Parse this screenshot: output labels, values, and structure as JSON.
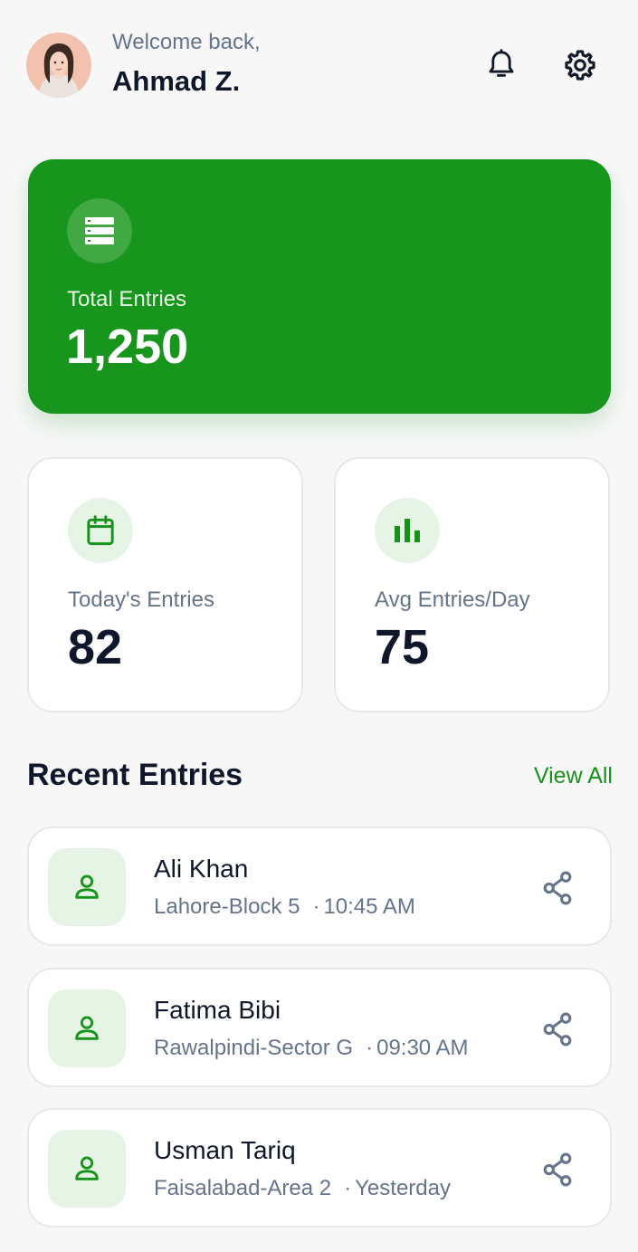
{
  "header": {
    "welcome": "Welcome back,",
    "user_name": "Ahmad Z.",
    "avatar_icon": "avatar",
    "notification_icon": "bell-icon",
    "settings_icon": "gear-icon"
  },
  "total": {
    "label": "Total Entries",
    "value": "1,250",
    "icon": "database-icon",
    "color": "#18951c"
  },
  "stats": [
    {
      "label": "Today's Entries",
      "value": "82",
      "icon": "calendar-icon"
    },
    {
      "label": "Avg Entries/Day",
      "value": "75",
      "icon": "bar-chart-icon"
    }
  ],
  "recent": {
    "title": "Recent Entries",
    "view_all": "View All",
    "entries": [
      {
        "name": "Ali Khan",
        "location": "Lahore-Block 5",
        "time": "10:45 AM"
      },
      {
        "name": "Fatima Bibi",
        "location": "Rawalpindi-Sector G",
        "time": "09:30 AM"
      },
      {
        "name": "Usman Tariq",
        "location": "Faisalabad-Area 2",
        "time": "Yesterday"
      }
    ]
  },
  "colors": {
    "accent": "#17921b",
    "background": "#f7f7f8",
    "muted_text": "#64748b",
    "primary_text": "#0f172a"
  }
}
